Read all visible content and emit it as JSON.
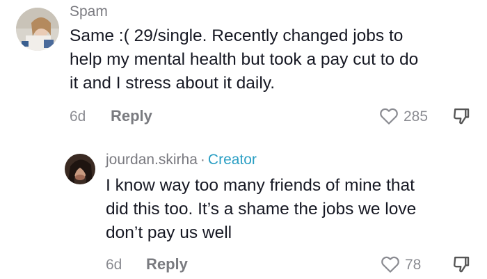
{
  "comments": [
    {
      "username": "Spam",
      "lines": [
        "Same :( 29/single. Recently changed jobs to",
        "help my mental health but took a pay cut to do",
        "it and I stress about it daily."
      ],
      "age": "6d",
      "reply_label": "Reply",
      "likes": "285",
      "like_icon": "heart-outline-icon",
      "dislike_icon": "thumbs-down-outline-icon"
    },
    {
      "username": "jourdan.skirha",
      "separator": "·",
      "badge": "Creator",
      "lines": [
        "I know way too many friends of mine that",
        "did this too. It’s a shame the jobs we love",
        "don’t pay us well"
      ],
      "age": "6d",
      "reply_label": "Reply",
      "likes": "78",
      "like_icon": "heart-outline-icon",
      "dislike_icon": "thumbs-down-outline-icon"
    }
  ],
  "colors": {
    "text": "#161823",
    "muted": "#8a8b91",
    "creator_badge": "#2b9fc4"
  }
}
